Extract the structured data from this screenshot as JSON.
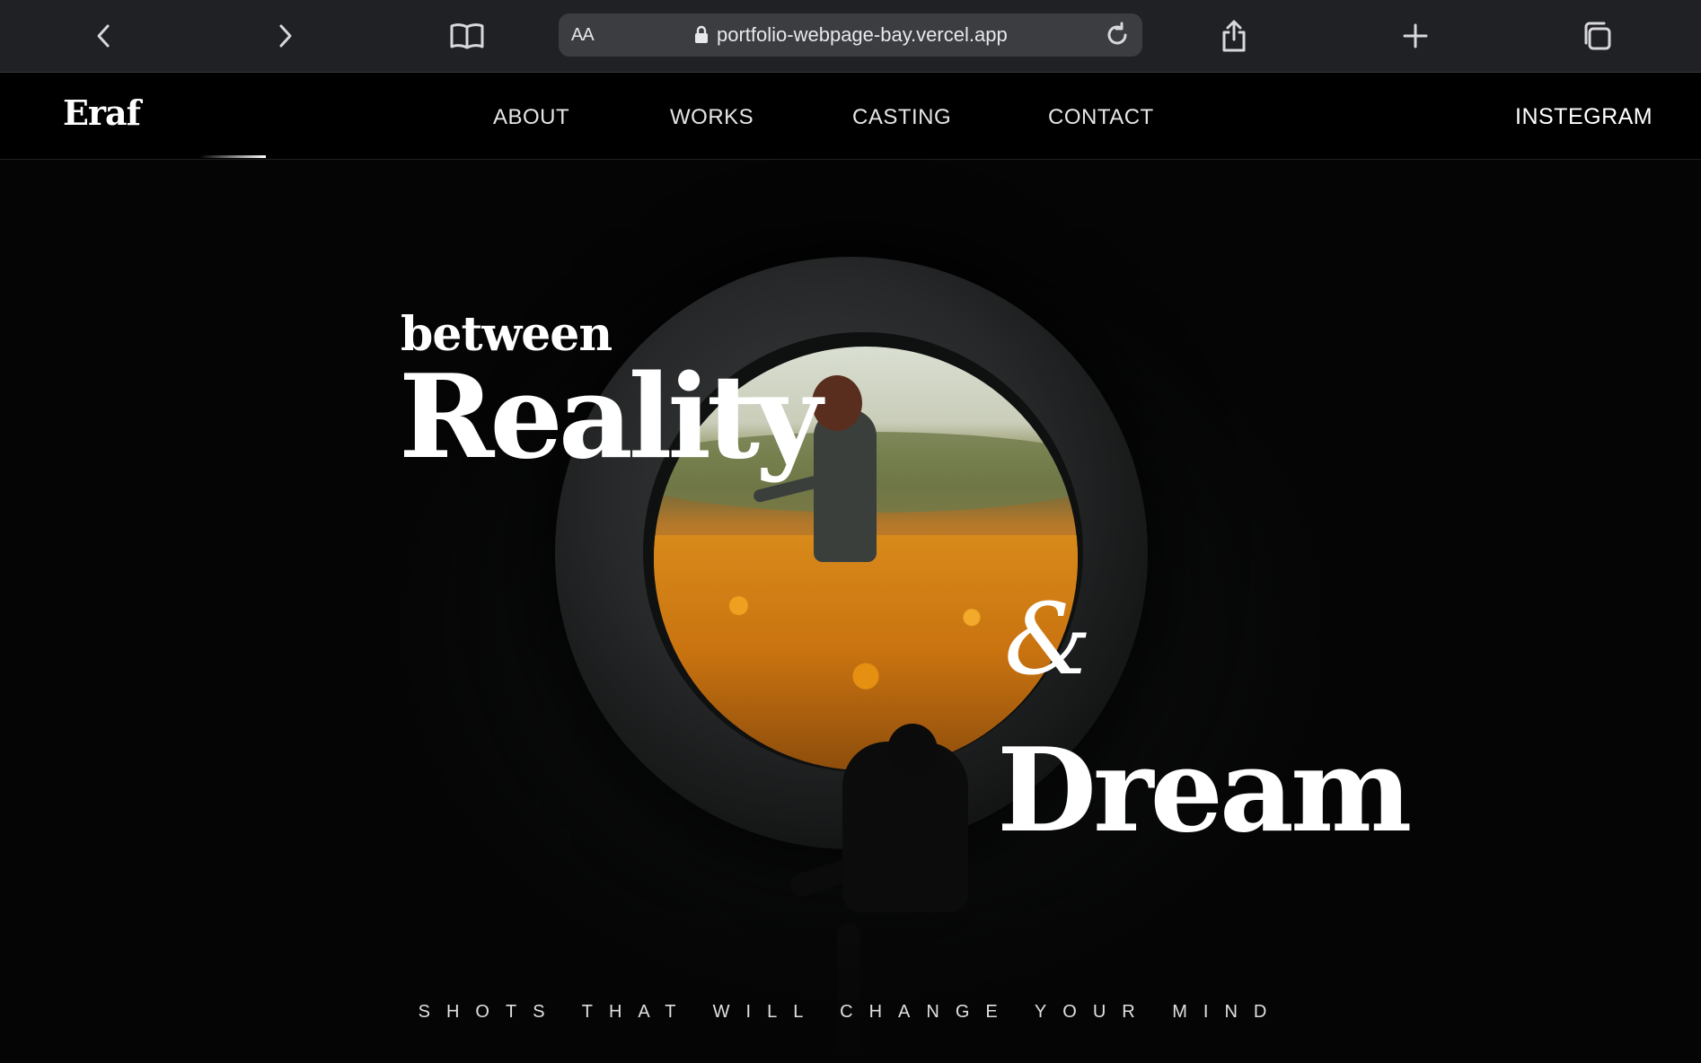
{
  "browser": {
    "text_size_label": "AA",
    "url": "portfolio-webpage-bay.vercel.app"
  },
  "site": {
    "logo": "Eraf",
    "nav": [
      "ABOUT",
      "WORKS",
      "CASTING",
      "CONTACT"
    ],
    "social": "INSTEGRAM"
  },
  "hero": {
    "word_between": "between",
    "word_reality": "Reality",
    "word_amp": "&",
    "word_dream": "Dream",
    "tagline": "SHOTS THAT WILL CHANGE YOUR MIND"
  },
  "colors": {
    "chrome_bg": "#1f2124",
    "urlbar_bg": "#3b3d41",
    "page_bg": "#000000",
    "accent_field": "#d4861a"
  },
  "icons": [
    "back-icon",
    "forward-icon",
    "bookmarks-icon",
    "lock-icon",
    "reload-icon",
    "share-icon",
    "new-tab-icon",
    "tabs-icon"
  ]
}
